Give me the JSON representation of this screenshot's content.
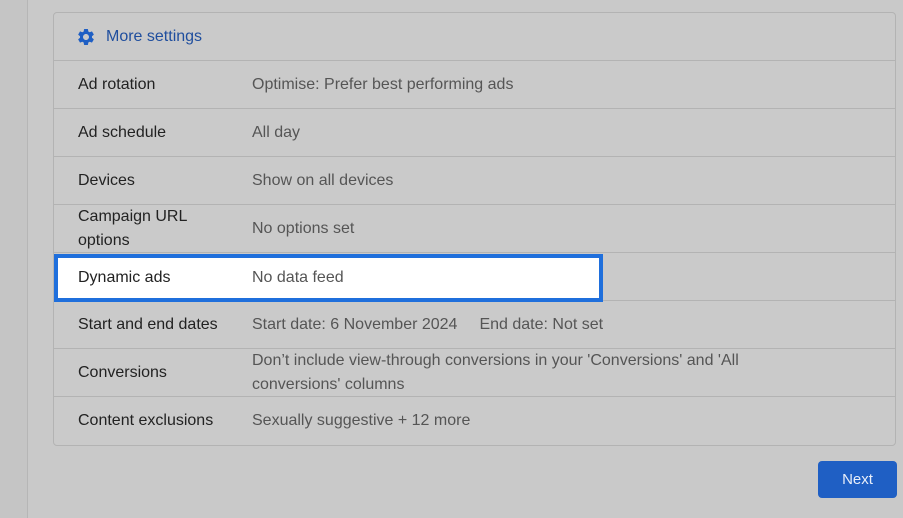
{
  "header": {
    "title": "More settings",
    "icon": "gear-icon"
  },
  "rows": [
    {
      "label": "Ad rotation",
      "value": "Optimise: Prefer best performing ads"
    },
    {
      "label": "Ad schedule",
      "value": "All day"
    },
    {
      "label": "Devices",
      "value": "Show on all devices"
    },
    {
      "label": "Campaign URL options",
      "value": "No options set"
    },
    {
      "label": "Dynamic ads",
      "value": "No data feed"
    },
    {
      "label": "Start and end dates",
      "value": "Start date: 6 November 2024",
      "value2": "End date: Not set"
    },
    {
      "label": "Conversions",
      "value": "Don’t include view-through conversions in your 'Conversions' and 'All conversions' columns"
    },
    {
      "label": "Content exclusions",
      "value": "Sexually suggestive + 12 more"
    }
  ],
  "footer": {
    "next_label": "Next"
  },
  "colors": {
    "accent": "#1f6fdc",
    "header_text": "#1f4e9e",
    "button": "#1f5fc4"
  }
}
